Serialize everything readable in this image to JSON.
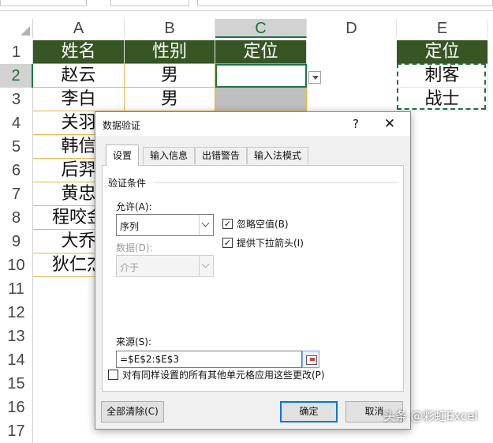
{
  "sheet": {
    "columns": [
      "A",
      "B",
      "C",
      "D",
      "E"
    ],
    "active_column": "C",
    "rows": [
      "1",
      "2",
      "3",
      "4",
      "5",
      "6",
      "7",
      "8",
      "9",
      "10",
      "11",
      "12",
      "13",
      "14",
      "15",
      "16",
      "17"
    ],
    "active_row": "2",
    "header_row": {
      "a": "姓名",
      "b": "性别",
      "c": "定位",
      "e": "定位"
    },
    "data": [
      {
        "a": "赵云",
        "b": "男"
      },
      {
        "a": "李白",
        "b": "男"
      },
      {
        "a": "关羽"
      },
      {
        "a": "韩信"
      },
      {
        "a": "后羿"
      },
      {
        "a": "黄忠"
      },
      {
        "a": "程咬金"
      },
      {
        "a": "大乔"
      },
      {
        "a": "狄仁杰"
      }
    ],
    "list_values": [
      "刺客",
      "战士"
    ]
  },
  "dialog": {
    "title": "数据验证",
    "help": "?",
    "close": "✕",
    "tabs": [
      "设置",
      "输入信息",
      "出错警告",
      "输入法模式"
    ],
    "group_title": "验证条件",
    "allow_label": "允许(A):",
    "allow_value": "序列",
    "data_label": "数据(D):",
    "data_value": "介于",
    "ignore_blank_label": "忽略空值(B)",
    "dropdown_label": "提供下拉箭头(I)",
    "check_mark": "✓",
    "source_label": "来源(S):",
    "source_value": "=$E$2:$E$3",
    "apply_all_label": "对有同样设置的所有其他单元格应用这些更改(P)",
    "clear_all": "全部清除(C)",
    "ok": "确定",
    "cancel": "取消"
  },
  "watermark": "头条 @彩虹Excel"
}
